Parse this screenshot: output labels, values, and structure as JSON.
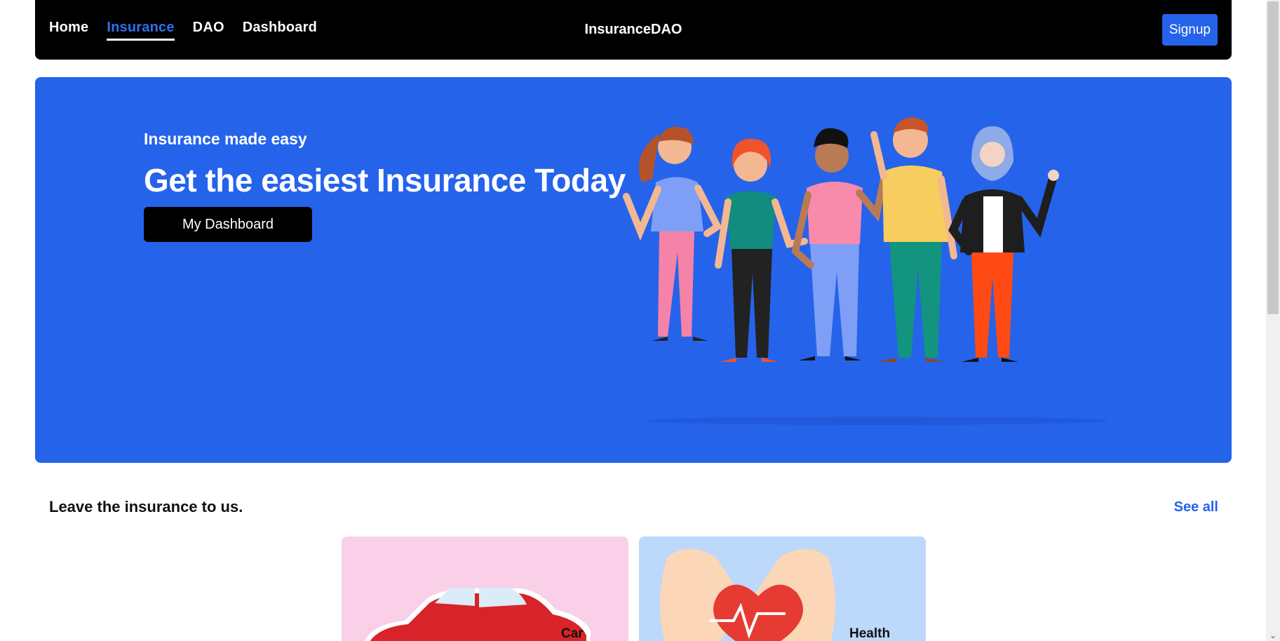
{
  "nav": {
    "links": [
      {
        "label": "Home",
        "active": false
      },
      {
        "label": "Insurance",
        "active": true
      },
      {
        "label": "DAO",
        "active": false
      },
      {
        "label": "Dashboard",
        "active": false
      }
    ],
    "brand": "InsuranceDAO",
    "signup_label": "Signup"
  },
  "hero": {
    "subtitle": "Insurance made easy",
    "title": "Get the easiest Insurance Today",
    "button_label": "My Dashboard",
    "illustration": "group-of-people-illustration"
  },
  "section": {
    "title": "Leave the insurance to us.",
    "see_all_label": "See all",
    "cards": [
      {
        "label": "Car",
        "icon": "car-illustration",
        "bg": "#f9d0e8"
      },
      {
        "label": "Health",
        "icon": "heart-in-hands-illustration",
        "bg": "#bcd8fb"
      }
    ]
  },
  "colors": {
    "accent": "#2563eb",
    "nav_bg": "#000000",
    "hero_bg": "#2563eb"
  }
}
